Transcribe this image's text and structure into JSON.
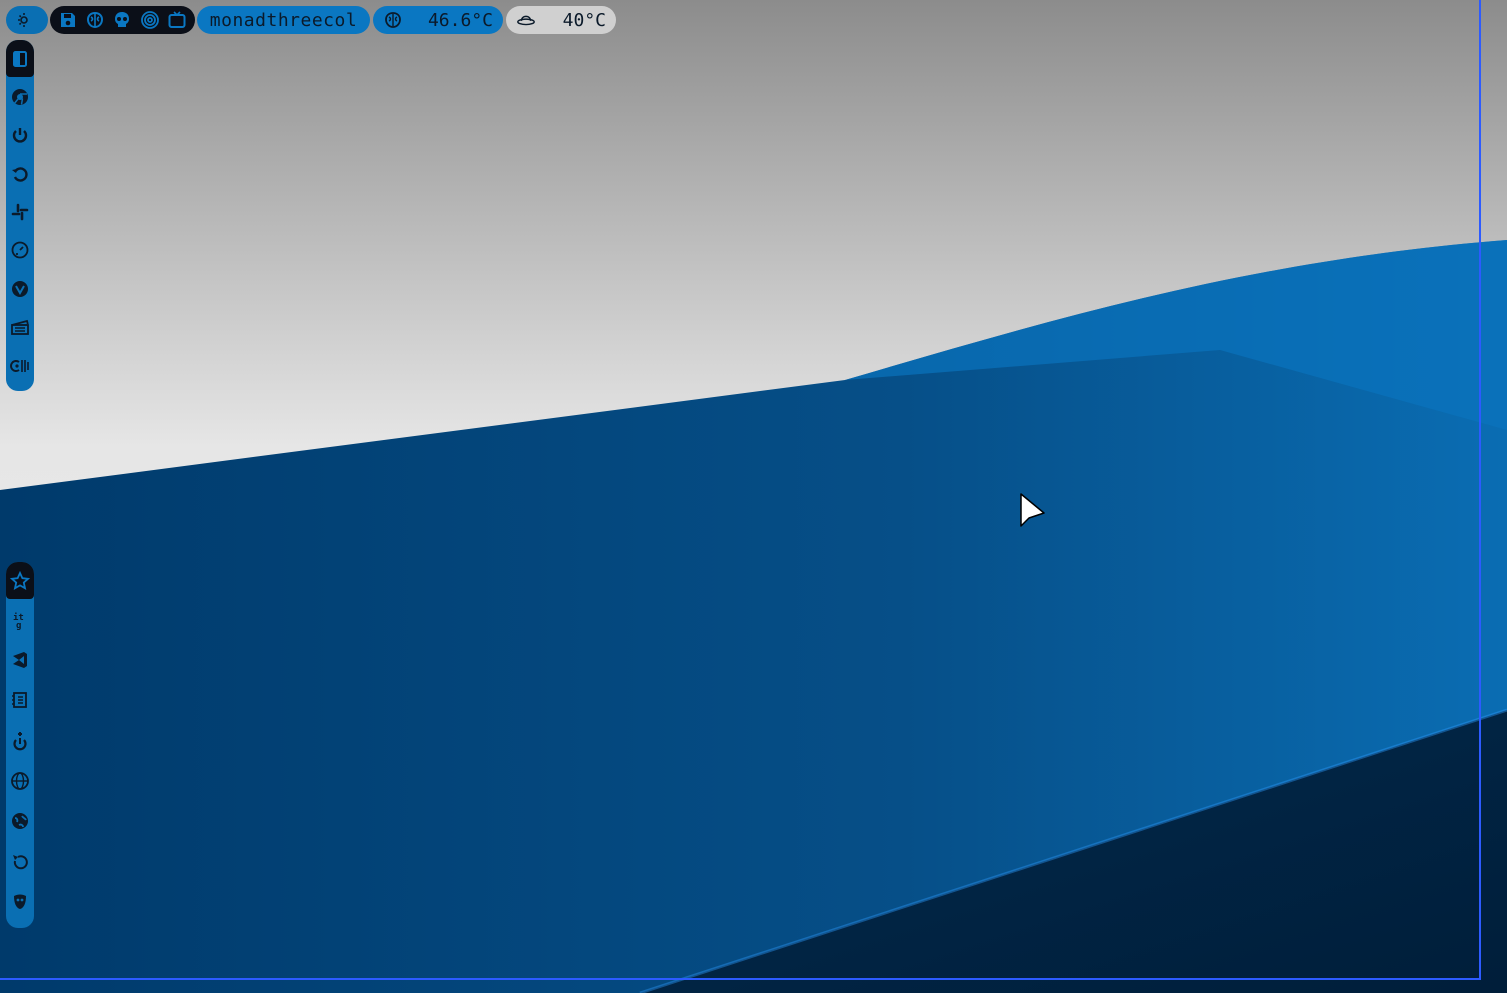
{
  "colors": {
    "bar_blue": "#0a77c2",
    "bar_dark": "#0b0f18",
    "weather_bg": "#d0d0d0",
    "wallpaper_sky": "#e9e9e9",
    "wallpaper_blue": "#0a4b83",
    "frame_border": "#2d5bff"
  },
  "topbar": {
    "menu_icon": "sun-moon-icon",
    "apps": [
      {
        "icon": "save-icon"
      },
      {
        "icon": "brain-icon"
      },
      {
        "icon": "skull-icon"
      },
      {
        "icon": "target-icon"
      },
      {
        "icon": "tv-icon"
      }
    ],
    "layout_name": "monadthreecol",
    "cpu": {
      "icon": "brain-icon",
      "temp": "46.6°C"
    },
    "weather": {
      "icon": "ufo-icon",
      "temp": "40°C"
    }
  },
  "dock_top": {
    "active_icon": "window-icon",
    "items": [
      {
        "icon": "chrome-icon"
      },
      {
        "icon": "power-icon"
      },
      {
        "icon": "refresh-icon"
      },
      {
        "icon": "slack-icon"
      },
      {
        "icon": "clock-icon"
      },
      {
        "icon": "vivaldi-icon"
      },
      {
        "icon": "clapperboard-icon"
      },
      {
        "icon": "audio-icon"
      }
    ]
  },
  "dock_bottom": {
    "active_icon": "star-icon",
    "items": [
      {
        "icon": "git-icon"
      },
      {
        "icon": "visual-studio-icon"
      },
      {
        "icon": "notebook-icon"
      },
      {
        "icon": "power-plus-icon"
      },
      {
        "icon": "globe-icon"
      },
      {
        "icon": "earth-icon"
      },
      {
        "icon": "restart-icon"
      },
      {
        "icon": "mask-icon"
      }
    ]
  }
}
